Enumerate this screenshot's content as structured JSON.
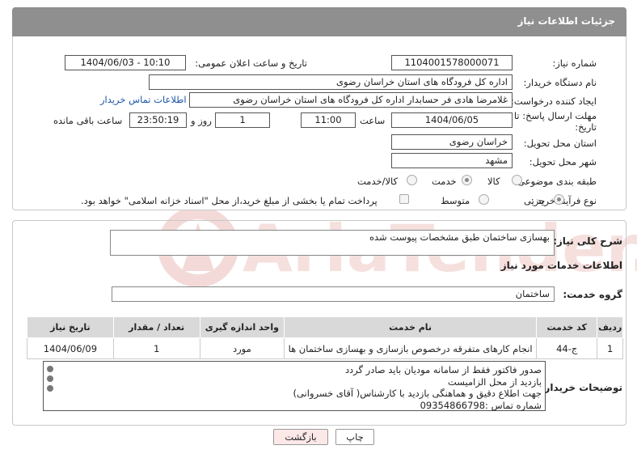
{
  "header": {
    "title": "جزئیات اطلاعات نیاز"
  },
  "form": {
    "need_number": {
      "label": "شماره نیاز:",
      "value": "1104001578000071"
    },
    "announce_datetime": {
      "label": "تاریخ و ساعت اعلان عمومی:",
      "value": "1404/06/03 - 10:10"
    },
    "buyer_org": {
      "label": "نام دستگاه خریدار:",
      "value": "اداره کل فرودگاه های استان خراسان رضوی"
    },
    "requester": {
      "label": "ایجاد کننده درخواست:",
      "value": "غلامرضا هادی فر حسابدار اداره کل فرودگاه های استان خراسان رضوی",
      "contact_link": "اطلاعات تماس خریدار"
    },
    "deadline": {
      "label_line1": "مهلت ارسال پاسخ: تا",
      "label_line2": "تاریخ:",
      "date": "1404/06/05",
      "time_label": "ساعت",
      "time": "11:00",
      "days": "1",
      "days_label": "روز و",
      "remaining": "23:50:19",
      "remaining_label": "ساعت باقی مانده"
    },
    "province": {
      "label": "استان محل تحویل:",
      "value": "خراسان رضوی"
    },
    "city": {
      "label": "شهر محل تحویل:",
      "value": "مشهد"
    },
    "category": {
      "label": "طبقه بندی موضوعی:",
      "options": [
        "کالا",
        "خدمت",
        "کالا/خدمت"
      ],
      "selected": "خدمت"
    },
    "purchase_type": {
      "label": "نوع فرآیند خرید :",
      "options": [
        "جزیی",
        "متوسط"
      ],
      "selected": "جزیی",
      "treasury_note": "پرداخت تمام یا بخشی از مبلغ خرید،از محل \"اسناد خزانه اسلامی\" خواهد بود."
    }
  },
  "summary": {
    "label": "شرح کلی نیاز:",
    "value": "بهسازی ساختمان طبق مشخصات پیوست شده"
  },
  "services": {
    "title": "اطلاعات خدمات مورد نیاز",
    "group_label": "گروه خدمت:",
    "group_value": "ساختمان",
    "columns": [
      "ردیف",
      "کد خدمت",
      "نام خدمت",
      "واحد اندازه گیری",
      "تعداد / مقدار",
      "تاریخ نیاز"
    ],
    "rows": [
      {
        "row": "1",
        "code": "ج-44",
        "name": "انجام کارهای متفرقه درخصوص بازسازی و بهسازی ساختمان ها",
        "unit": "مورد",
        "qty": "1",
        "date": "1404/06/09"
      }
    ]
  },
  "notes": {
    "label": "توضیحات خریدار:",
    "lines": [
      "صدور فاکتور فقط از سامانه مودیان باید صادر گردد",
      "بازدید از محل الزامیست",
      "جهت اطلاع دقیق و هماهنگی بازدید با کارشناس( آقای خسروانی)",
      "شماره تماس :09354866798"
    ]
  },
  "buttons": {
    "print": "چاپ",
    "back": "بازگشت"
  },
  "watermark": {
    "text": "AriaTender.neT"
  },
  "colors": {
    "header": "#8f8f8f",
    "link": "#1a56a8",
    "back_button": "#fde8e8"
  }
}
